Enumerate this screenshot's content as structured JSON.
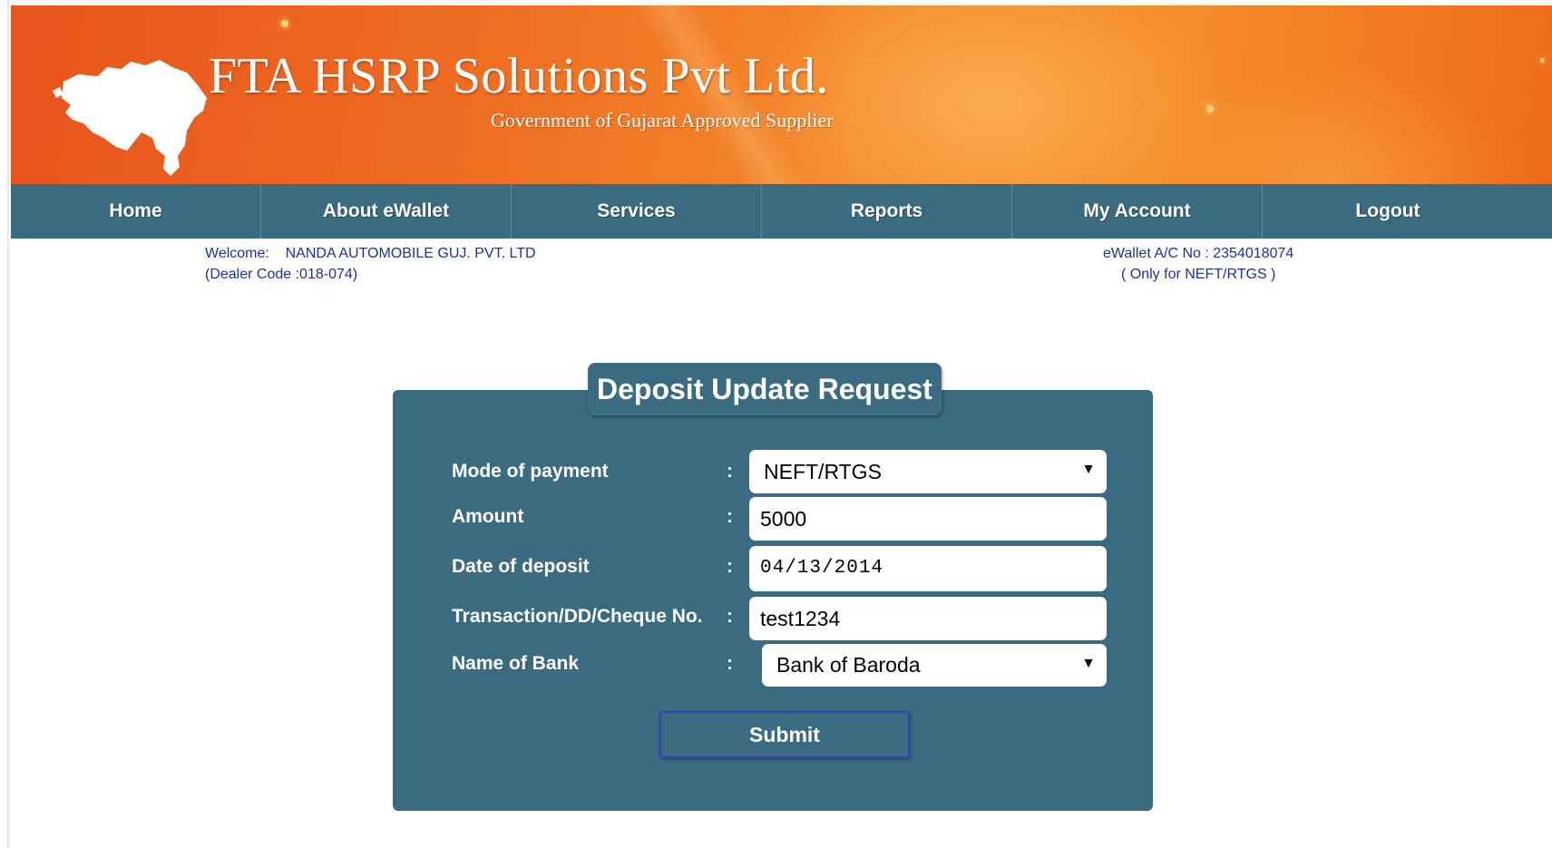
{
  "header": {
    "title": "FTA HSRP Solutions Pvt Ltd.",
    "subtitle": "Government of Gujarat Approved Supplier",
    "logo_icon": "gujarat-map-icon"
  },
  "nav": {
    "items": [
      {
        "label": "Home"
      },
      {
        "label": "About eWallet"
      },
      {
        "label": "Services"
      },
      {
        "label": "Reports"
      },
      {
        "label": "My Account"
      },
      {
        "label": "Logout"
      }
    ]
  },
  "user": {
    "welcome_label": "Welcome:",
    "dealer_name": "NANDA AUTOMOBILE GUJ. PVT. LTD",
    "dealer_code": "(Dealer Code :018-074)",
    "ewallet_label": "eWallet A/C No :",
    "ewallet_number": "2354018074",
    "ewallet_note": "( Only for NEFT/RTGS )"
  },
  "form": {
    "title": "Deposit Update Request",
    "colon": ":",
    "fields": [
      {
        "label": "Mode of payment",
        "value": "NEFT/RTGS",
        "type": "select"
      },
      {
        "label": "Amount",
        "value": "5000",
        "type": "text"
      },
      {
        "label": "Date of deposit",
        "value": "04/13/2014",
        "type": "date"
      },
      {
        "label": "Transaction/DD/Cheque No.",
        "value": "test1234",
        "type": "text"
      },
      {
        "label": "Name of Bank",
        "value": "Bank of Baroda",
        "type": "select"
      }
    ],
    "submit_label": "Submit"
  },
  "colors": {
    "banner_orange": "#ef6d22",
    "nav_teal": "#3a6b80",
    "info_text_blue": "#1f2fa8",
    "button_border": "#2e43b5"
  }
}
